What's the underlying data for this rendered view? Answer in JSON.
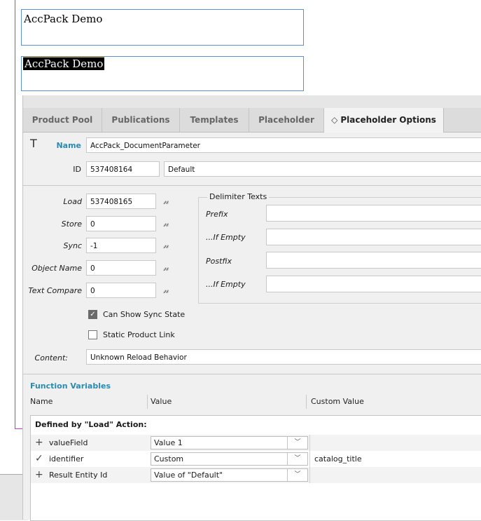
{
  "canvas": {
    "frame1_text": "AccPack Demo",
    "frame2_text": "AccPack Demo"
  },
  "tabs": [
    {
      "label": "Product Pool"
    },
    {
      "label": "Publications"
    },
    {
      "label": "Templates"
    },
    {
      "label": "Placeholder"
    },
    {
      "label": "Placeholder Options",
      "active": true
    }
  ],
  "tab_chevron": "◇",
  "header": {
    "type_glyph": "T",
    "name_label": "Name",
    "name_value": "AccPack_DocumentParameter",
    "id_label": "ID",
    "id_value": "537408164",
    "id_extra": "Default"
  },
  "actions": {
    "load_label": "Load",
    "load_value": "537408165",
    "store_label": "Store",
    "store_value": "0",
    "sync_label": "Sync",
    "sync_value": "-1",
    "object_name_label": "Object Name",
    "object_name_value": "0",
    "text_compare_label": "Text Compare",
    "text_compare_value": "0"
  },
  "delimiter": {
    "legend": "Delimiter Texts",
    "prefix_label": "Prefix",
    "prefix_value": "",
    "if_empty1_label": "...If Empty",
    "if_empty1_value": "",
    "postfix_label": "Postfix",
    "postfix_value": "",
    "if_empty2_label": "...If Empty",
    "if_empty2_value": ""
  },
  "options": {
    "can_show_sync_state": "Can Show Sync State",
    "can_show_sync_state_checked": true,
    "static_product_link": "Static Product Link",
    "static_product_link_checked": false
  },
  "content": {
    "label": "Content:",
    "value": "Unknown Reload Behavior"
  },
  "function_variables": {
    "title": "Function Variables",
    "col_name": "Name",
    "col_value": "Value",
    "col_custom": "Custom Value",
    "group_label": "Defined by \"Load\" Action:",
    "rows": [
      {
        "icon": "plus-icon",
        "glyph": "+",
        "name": "valueField",
        "value": "Value 1",
        "custom": ""
      },
      {
        "icon": "check-icon",
        "glyph": "✓",
        "name": "identifier",
        "value": "Custom",
        "custom": "catalog_title"
      },
      {
        "icon": "plus-icon",
        "glyph": "+",
        "name": "Result Entity Id",
        "value": "Value of \"Default\"",
        "custom": ""
      }
    ]
  },
  "dropdown_glyph": "﹀"
}
